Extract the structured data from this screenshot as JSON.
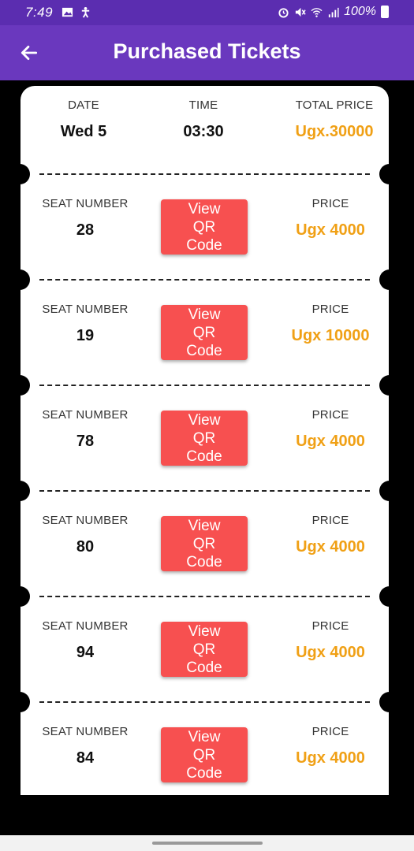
{
  "status_bar": {
    "time": "7:49",
    "battery": "100%",
    "icons": [
      "gallery-icon",
      "accessibility-icon",
      "alarm-icon",
      "mute-icon",
      "wifi-icon",
      "signal-icon",
      "battery-icon"
    ]
  },
  "app_bar": {
    "title": "Purchased Tickets",
    "back_icon": "arrow-left-icon"
  },
  "header": {
    "date_label": "DATE",
    "date_value": "Wed 5",
    "time_label": "TIME",
    "time_value": "03:30",
    "total_label": "TOTAL PRICE",
    "total_value": "Ugx.30000"
  },
  "tickets": [
    {
      "seat_label": "SEAT NUMBER",
      "seat": "28",
      "button": "View QR Code",
      "price_label": "PRICE",
      "price": "Ugx 4000"
    },
    {
      "seat_label": "SEAT NUMBER",
      "seat": "19",
      "button": "View QR Code",
      "price_label": "PRICE",
      "price": "Ugx 10000"
    },
    {
      "seat_label": "SEAT NUMBER",
      "seat": "78",
      "button": "View QR Code",
      "price_label": "PRICE",
      "price": "Ugx 4000"
    },
    {
      "seat_label": "SEAT NUMBER",
      "seat": "80",
      "button": "View QR Code",
      "price_label": "PRICE",
      "price": "Ugx 4000"
    },
    {
      "seat_label": "SEAT NUMBER",
      "seat": "94",
      "button": "View QR Code",
      "price_label": "PRICE",
      "price": "Ugx 4000"
    },
    {
      "seat_label": "SEAT NUMBER",
      "seat": "84",
      "button": "View QR Code",
      "price_label": "PRICE",
      "price": "Ugx 4000"
    }
  ],
  "colors": {
    "app_bar": "#6a38be",
    "status_bar": "#5b2db0",
    "button": "#f75050",
    "price": "#f0a015"
  }
}
